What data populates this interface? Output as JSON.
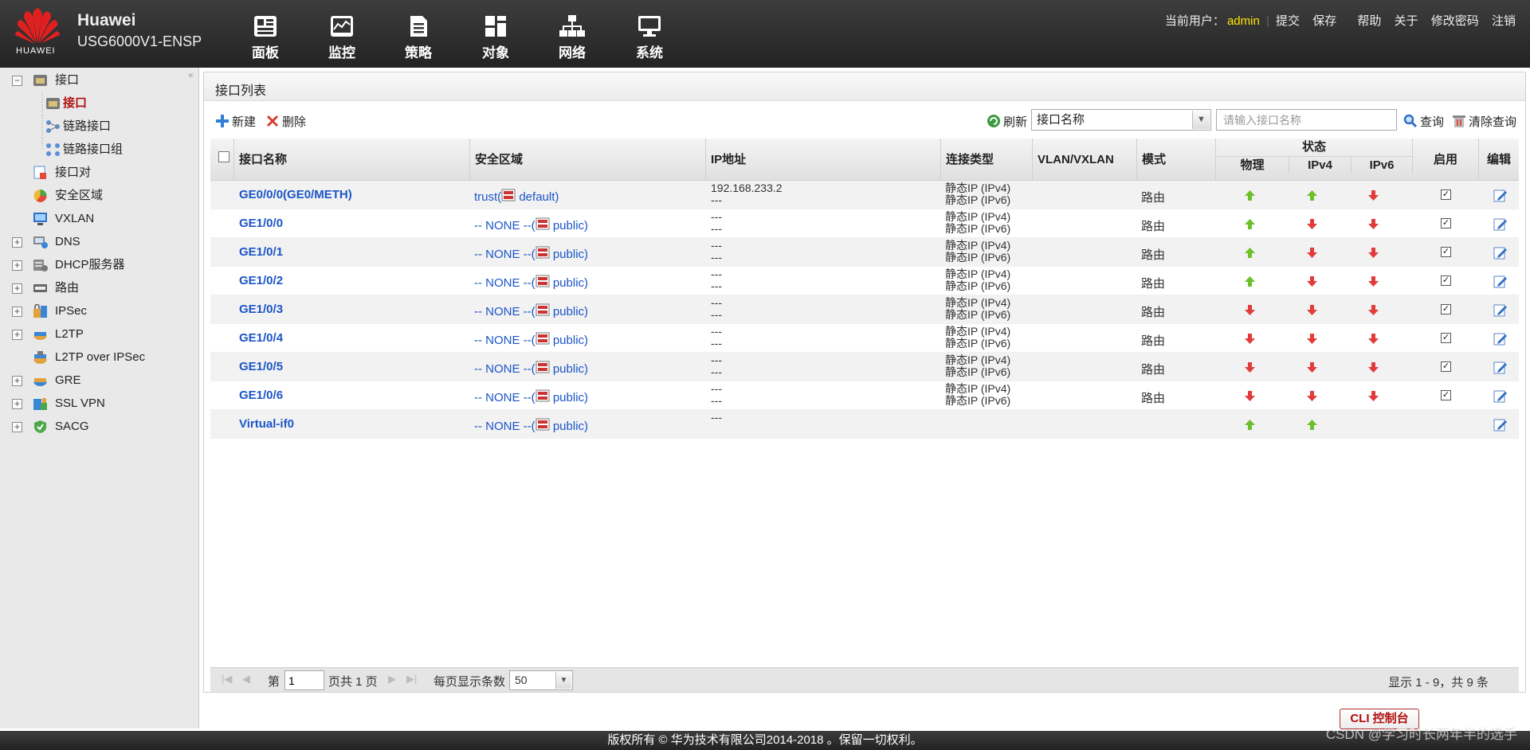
{
  "header": {
    "logo_text": "HUAWEI",
    "brand": "Huawei",
    "model": "USG6000V1-ENSP",
    "nav": [
      {
        "label": "面板",
        "icon": "dashboard-icon"
      },
      {
        "label": "监控",
        "icon": "monitor-icon"
      },
      {
        "label": "策略",
        "icon": "policy-icon"
      },
      {
        "label": "对象",
        "icon": "object-icon"
      },
      {
        "label": "网络",
        "icon": "network-icon"
      },
      {
        "label": "系统",
        "icon": "system-icon"
      }
    ],
    "current_user_label": "当前用户：",
    "current_user": "admin",
    "links": [
      "提交",
      "保存",
      "帮助",
      "关于",
      "修改密码",
      "注销"
    ]
  },
  "sidebar": {
    "items": [
      {
        "label": "接口",
        "expander": "−"
      },
      {
        "label": "接口"
      },
      {
        "label": "链路接口"
      },
      {
        "label": "链路接口组"
      },
      {
        "label": "接口对"
      },
      {
        "label": "安全区域"
      },
      {
        "label": "VXLAN"
      },
      {
        "label": "DNS",
        "expander": "+"
      },
      {
        "label": "DHCP服务器",
        "expander": "+"
      },
      {
        "label": "路由",
        "expander": "+"
      },
      {
        "label": "IPSec",
        "expander": "+"
      },
      {
        "label": "L2TP",
        "expander": "+"
      },
      {
        "label": "L2TP over IPSec"
      },
      {
        "label": "GRE",
        "expander": "+"
      },
      {
        "label": "SSL VPN",
        "expander": "+"
      },
      {
        "label": "SACG",
        "expander": "+"
      }
    ],
    "collapse_glyph": "«"
  },
  "panel": {
    "title": "接口列表",
    "new_label": "新建",
    "delete_label": "删除",
    "refresh_label": "刷新",
    "filter_field": "接口名称",
    "search_placeholder": "请输入接口名称",
    "query_label": "查询",
    "clear_label": "清除查询"
  },
  "table": {
    "headers": {
      "name": "接口名称",
      "zone": "安全区域",
      "ip": "IP地址",
      "conn_type": "连接类型",
      "vlan": "VLAN/VXLAN",
      "mode": "模式",
      "status": "状态",
      "physical": "物理",
      "ipv4": "IPv4",
      "ipv6": "IPv6",
      "enabled": "启用",
      "edit": "编辑"
    },
    "rows": [
      {
        "name": "GE0/0/0(GE0/METH)",
        "zone_prefix": "trust(",
        "zone_vsys": "default)",
        "ip1": "192.168.233.2",
        "ip2": "---",
        "type1": "静态IP (IPv4)",
        "type2": "静态IP (IPv6)",
        "mode": "路由",
        "phys": "up",
        "v4": "up",
        "v6": "down",
        "enabled": true
      },
      {
        "name": "GE1/0/0",
        "zone_prefix": "-- NONE --(",
        "zone_vsys": "public)",
        "ip1": "---",
        "ip2": "---",
        "type1": "静态IP (IPv4)",
        "type2": "静态IP (IPv6)",
        "mode": "路由",
        "phys": "up",
        "v4": "down",
        "v6": "down",
        "enabled": true
      },
      {
        "name": "GE1/0/1",
        "zone_prefix": "-- NONE --(",
        "zone_vsys": "public)",
        "ip1": "---",
        "ip2": "---",
        "type1": "静态IP (IPv4)",
        "type2": "静态IP (IPv6)",
        "mode": "路由",
        "phys": "up",
        "v4": "down",
        "v6": "down",
        "enabled": true
      },
      {
        "name": "GE1/0/2",
        "zone_prefix": "-- NONE --(",
        "zone_vsys": "public)",
        "ip1": "---",
        "ip2": "---",
        "type1": "静态IP (IPv4)",
        "type2": "静态IP (IPv6)",
        "mode": "路由",
        "phys": "up",
        "v4": "down",
        "v6": "down",
        "enabled": true
      },
      {
        "name": "GE1/0/3",
        "zone_prefix": "-- NONE --(",
        "zone_vsys": "public)",
        "ip1": "---",
        "ip2": "---",
        "type1": "静态IP (IPv4)",
        "type2": "静态IP (IPv6)",
        "mode": "路由",
        "phys": "down",
        "v4": "down",
        "v6": "down",
        "enabled": true
      },
      {
        "name": "GE1/0/4",
        "zone_prefix": "-- NONE --(",
        "zone_vsys": "public)",
        "ip1": "---",
        "ip2": "---",
        "type1": "静态IP (IPv4)",
        "type2": "静态IP (IPv6)",
        "mode": "路由",
        "phys": "down",
        "v4": "down",
        "v6": "down",
        "enabled": true
      },
      {
        "name": "GE1/0/5",
        "zone_prefix": "-- NONE --(",
        "zone_vsys": "public)",
        "ip1": "---",
        "ip2": "---",
        "type1": "静态IP (IPv4)",
        "type2": "静态IP (IPv6)",
        "mode": "路由",
        "phys": "down",
        "v4": "down",
        "v6": "down",
        "enabled": true
      },
      {
        "name": "GE1/0/6",
        "zone_prefix": "-- NONE --(",
        "zone_vsys": "public)",
        "ip1": "---",
        "ip2": "---",
        "type1": "静态IP (IPv4)",
        "type2": "静态IP (IPv6)",
        "mode": "路由",
        "phys": "down",
        "v4": "down",
        "v6": "down",
        "enabled": true
      },
      {
        "name": "Virtual-if0",
        "zone_prefix": "-- NONE --(",
        "zone_vsys": "public)",
        "ip1": "---",
        "ip2": "",
        "type1": "",
        "type2": "",
        "mode": "",
        "phys": "up",
        "v4": "up",
        "v6": "",
        "enabled": null
      }
    ]
  },
  "pager": {
    "page_prefix": "第",
    "page": "1",
    "page_suffix": "页共 1 页",
    "page_size_label": "每页显示条数",
    "page_size": "50",
    "summary": "显示 1 - 9，共 9 条"
  },
  "cli_label": "CLI 控制台",
  "footer": "版权所有 © 华为技术有限公司2014-2018 。保留一切权利。",
  "watermark": "CSDN @学习时长两年半的选手",
  "colors": {
    "up": "#6dbf2c",
    "down": "#e23b3b",
    "link": "#1a55c8",
    "user": "#ffe600"
  }
}
